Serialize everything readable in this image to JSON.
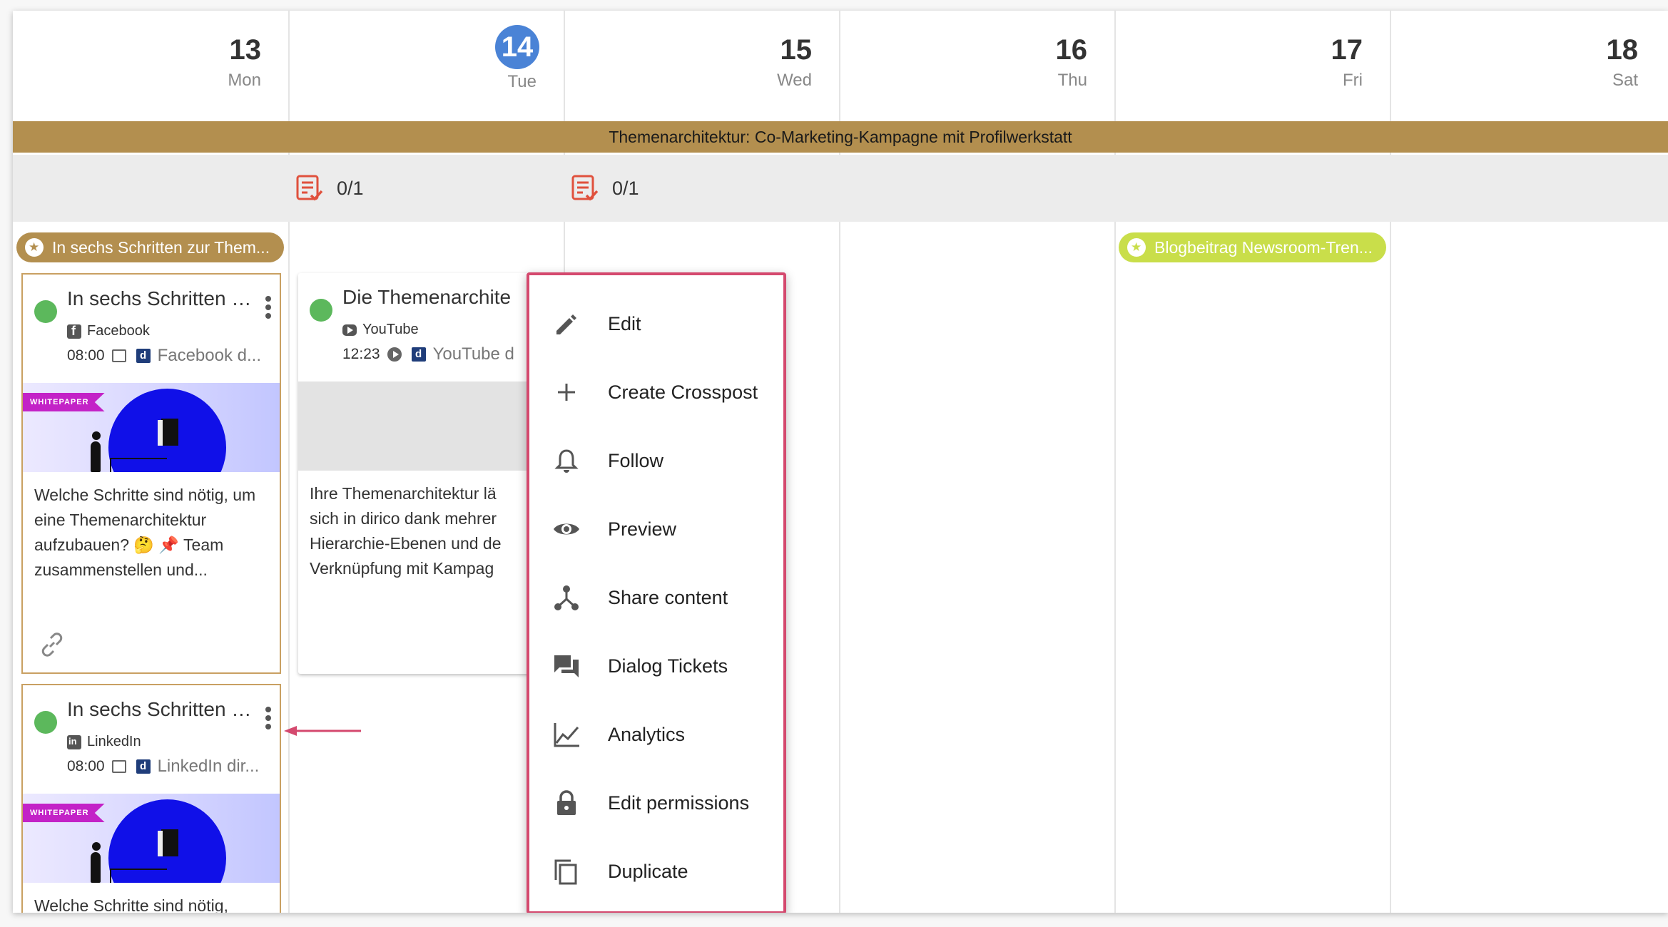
{
  "week": {
    "days": [
      {
        "num": "13",
        "name": "Mon"
      },
      {
        "num": "14",
        "name": "Tue",
        "today": true
      },
      {
        "num": "15",
        "name": "Wed"
      },
      {
        "num": "16",
        "name": "Thu"
      },
      {
        "num": "17",
        "name": "Fri"
      },
      {
        "num": "18",
        "name": "Sat"
      }
    ]
  },
  "campaign_bar": {
    "label": "Themenarchitektur: Co-Marketing-Kampagne mit Profilwerkstatt",
    "color": "#b38f4f"
  },
  "tasks": [
    {
      "day": "Tue",
      "count": "0/1"
    },
    {
      "day": "Wed",
      "count": "0/1"
    }
  ],
  "pills": [
    {
      "label": "In sechs Schritten zur Them...",
      "color": "#b38f4f"
    },
    {
      "label": "Blogbeitrag Newsroom-Tren...",
      "color": "#c9de4a"
    }
  ],
  "posts": [
    {
      "title": "In sechs Schritten z...",
      "channel": "Facebook",
      "time": "08:00",
      "target": "Facebook d...",
      "thumb_badge": "WHITEPAPER",
      "text": "Welche Schritte sind nötig, um eine Themenarchitektur aufzubauen? 🤔 📌 Team zusammenstellen und..."
    },
    {
      "title": "Die Themenarchite",
      "channel": "YouTube",
      "time": "12:23",
      "target": "YouTube d",
      "text": "Ihre Themenarchitektur lä sich in dirico dank mehrer Hierarchie-Ebenen und de Verknüpfung mit Kampag"
    },
    {
      "title": "In sechs Schritten z...",
      "channel": "LinkedIn",
      "time": "08:00",
      "target": "LinkedIn dir...",
      "thumb_badge": "WHITEPAPER",
      "text": "Welche Schritte sind nötig,"
    }
  ],
  "context_menu": {
    "items": [
      {
        "label": "Edit",
        "icon": "pencil-icon"
      },
      {
        "label": "Create Crosspost",
        "icon": "plus-icon"
      },
      {
        "label": "Follow",
        "icon": "bell-icon"
      },
      {
        "label": "Preview",
        "icon": "eye-icon"
      },
      {
        "label": "Share content",
        "icon": "share-icon"
      },
      {
        "label": "Dialog Tickets",
        "icon": "chat-icon"
      },
      {
        "label": "Analytics",
        "icon": "chart-icon"
      },
      {
        "label": "Edit permissions",
        "icon": "lock-icon"
      },
      {
        "label": "Duplicate",
        "icon": "copy-icon"
      }
    ]
  },
  "colors": {
    "today_circle": "#4a83d6",
    "status_green": "#5cb85c",
    "menu_border": "#d4496e",
    "task_red": "#e0513d"
  }
}
